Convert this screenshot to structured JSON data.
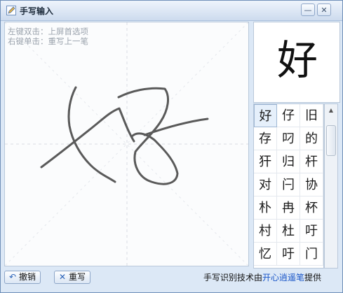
{
  "window": {
    "title": "手写输入",
    "minimize_label": "—",
    "close_label": "✕"
  },
  "canvas": {
    "hint_line_1": "左键双击：上屏首选项",
    "hint_line_2": "右键单击：重写上一笔"
  },
  "preview": {
    "character": "好"
  },
  "candidates": [
    "好",
    "仔",
    "旧",
    "存",
    "叼",
    "的",
    "犴",
    "归",
    "杆",
    "对",
    "闩",
    "协",
    "朴",
    "冉",
    "杯",
    "村",
    "杜",
    "吁",
    "忆",
    "吁",
    "门"
  ],
  "scrollbar": {
    "up_arrow": "▲"
  },
  "toolbar": {
    "undo_label": "撤销",
    "clear_label": "重写"
  },
  "footer": {
    "prefix": "手写识别技术由",
    "link": "开心逍遥笔",
    "suffix": "提供"
  },
  "colors": {
    "stroke": "#5a5a5a",
    "hint": "#9ba3ad",
    "link": "#1a56c8",
    "frame": "#dce8f6"
  }
}
